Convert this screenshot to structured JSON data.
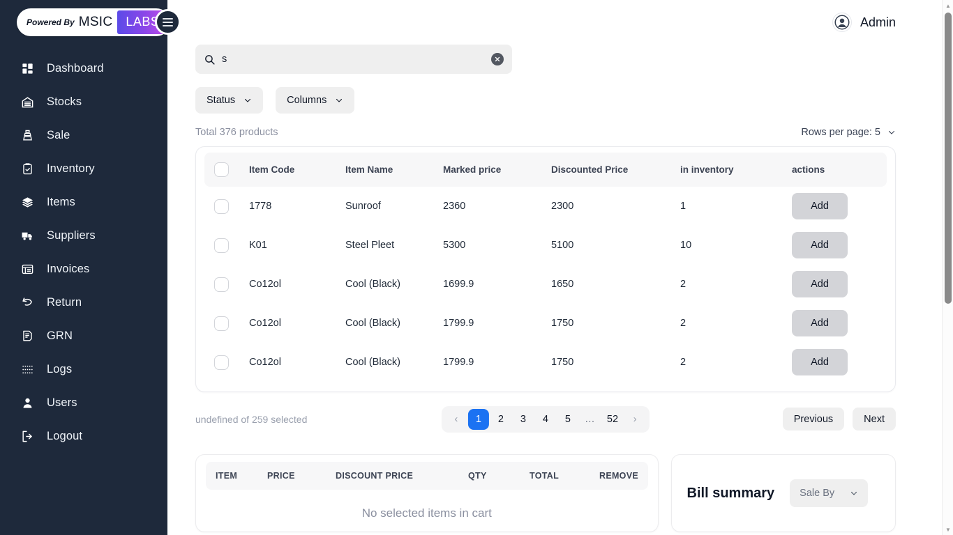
{
  "brand": {
    "powered_by": "Powered By",
    "name": "MSIC",
    "badge": "LABS",
    "menu_icon": "hamburger-icon"
  },
  "sidebar": {
    "items": [
      {
        "label": "Dashboard",
        "icon": "dashboard-grid-icon"
      },
      {
        "label": "Stocks",
        "icon": "warehouse-icon"
      },
      {
        "label": "Sale",
        "icon": "sale-stack-icon"
      },
      {
        "label": "Inventory",
        "icon": "clipboard-check-icon"
      },
      {
        "label": "Items",
        "icon": "layers-icon"
      },
      {
        "label": "Suppliers",
        "icon": "truck-icon"
      },
      {
        "label": "Invoices",
        "icon": "list-table-icon"
      },
      {
        "label": "Return",
        "icon": "return-arrow-icon"
      },
      {
        "label": "GRN",
        "icon": "document-note-icon"
      },
      {
        "label": "Logs",
        "icon": "dotted-list-icon"
      },
      {
        "label": "Users",
        "icon": "user-icon"
      },
      {
        "label": "Logout",
        "icon": "logout-icon"
      }
    ]
  },
  "topbar": {
    "user_name": "Admin",
    "avatar_icon": "user-circle-icon"
  },
  "search": {
    "value": "s",
    "placeholder": "",
    "icon": "search-icon",
    "clear_icon": "clear-circle-icon"
  },
  "filters": {
    "status_label": "Status",
    "columns_label": "Columns",
    "chevron_icon": "chevron-down-icon"
  },
  "meta": {
    "total_text": "Total 376 products",
    "rows_per_page_label": "Rows per page: 5"
  },
  "products_table": {
    "columns": [
      "Item Code",
      "Item Name",
      "Marked price",
      "Discounted Price",
      "in inventory",
      "actions"
    ],
    "action_label": "Add",
    "rows": [
      {
        "code": "1778",
        "name": "Sunroof",
        "marked": "2360",
        "discounted": "2300",
        "inventory": "1"
      },
      {
        "code": "K01",
        "name": "Steel Pleet",
        "marked": "5300",
        "discounted": "5100",
        "inventory": "10"
      },
      {
        "code": "Co12ol",
        "name": "Cool (Black)",
        "marked": "1699.9",
        "discounted": "1650",
        "inventory": "2"
      },
      {
        "code": "Co12ol",
        "name": "Cool (Black)",
        "marked": "1799.9",
        "discounted": "1750",
        "inventory": "2"
      },
      {
        "code": "Co12ol",
        "name": "Cool (Black)",
        "marked": "1799.9",
        "discounted": "1750",
        "inventory": "2"
      }
    ]
  },
  "pagination": {
    "selected_text": "undefined of 259 selected",
    "pages": [
      "1",
      "2",
      "3",
      "4",
      "5",
      "…",
      "52"
    ],
    "active_page": "1",
    "prev_arrow": "‹",
    "next_arrow": "›",
    "previous_label": "Previous",
    "next_label": "Next"
  },
  "cart": {
    "columns": [
      "ITEM",
      "PRICE",
      "DISCOUNT PRICE",
      "QTY",
      "TOTAL",
      "REMOVE"
    ],
    "empty_text": "No selected items in cart"
  },
  "bill": {
    "title": "Bill summary",
    "sale_by_label": "Sale By"
  },
  "colors": {
    "sidebar_bg": "#1e293b",
    "accent_blue": "#1b72f2",
    "badge_gradient_start": "#5b4be8",
    "badge_gradient_end": "#c04ce8",
    "add_button": "#d3d4d8"
  }
}
